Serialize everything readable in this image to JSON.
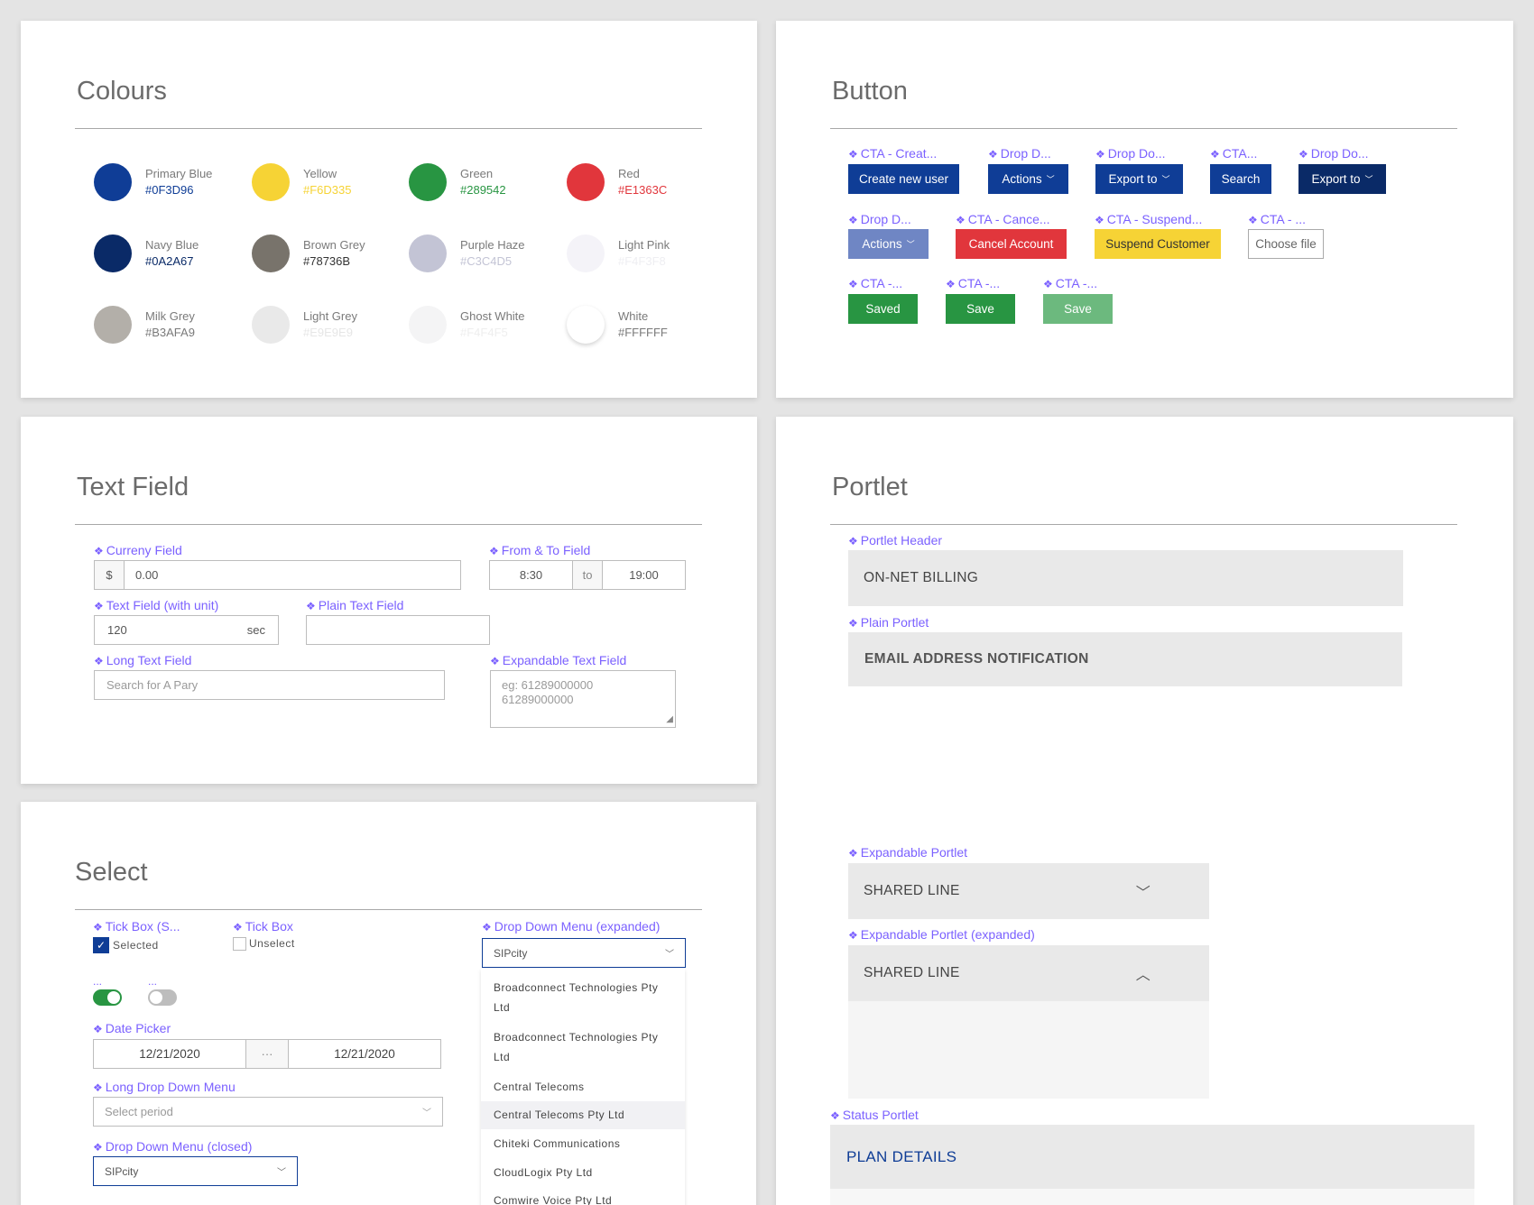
{
  "colours": {
    "title": "Colours",
    "items": [
      {
        "name": "Primary Blue",
        "hex": "#0F3D96",
        "color": "#0F3D96",
        "hex_color": "#0F3D96"
      },
      {
        "name": "Yellow",
        "hex": "#F6D335",
        "color": "#F6D335",
        "hex_color": "#F6D335"
      },
      {
        "name": "Green",
        "hex": "#289542",
        "color": "#289542",
        "hex_color": "#289542"
      },
      {
        "name": "Red",
        "hex": "#E1363C",
        "color": "#E1363C",
        "hex_color": "#E1363C"
      },
      {
        "name": "Navy Blue",
        "hex": "#0A2A67",
        "color": "#0A2A67",
        "hex_color": "#0A2A67"
      },
      {
        "name": "Brown Grey",
        "hex": "#78736B",
        "color": "#78736B",
        "hex_color": "#333333"
      },
      {
        "name": "Purple Haze",
        "hex": "#C3C4D5",
        "color": "#C3C4D5",
        "hex_color": "#C3C4D5"
      },
      {
        "name": "Light Pink",
        "hex": "#F4F3F8",
        "color": "#F4F3F8",
        "hex_color": "#EEEEF2"
      },
      {
        "name": "Milk Grey",
        "hex": "#B3AFA9",
        "color": "#B3AFA9",
        "hex_color": "#7A7A7A"
      },
      {
        "name": "Light Grey",
        "hex": "#E9E9E9",
        "color": "#E9E9E9",
        "hex_color": "#E6E6E6"
      },
      {
        "name": "Ghost White",
        "hex": "#F4F4F5",
        "color": "#F4F4F5",
        "hex_color": "#EEEEEE"
      },
      {
        "name": "White",
        "hex": "#FFFFFF",
        "color": "#FFFFFF",
        "hex_color": "#7A7A7A"
      }
    ]
  },
  "button": {
    "title": "Button",
    "labels": [
      "CTA - Creat...",
      "Drop D...",
      "Drop Do...",
      "CTA...",
      "Drop Do...",
      "Drop D...",
      "CTA - Cance...",
      "CTA - Suspend...",
      "CTA - ...",
      "CTA -...",
      "CTA -...",
      "CTA -..."
    ],
    "create_new_user": "Create new user",
    "actions": "Actions",
    "export_to": "Export to",
    "search": "Search",
    "cancel_account": "Cancel Account",
    "suspend_customer": "Suspend Customer",
    "choose_file": "Choose file",
    "saved": "Saved",
    "save": "Save",
    "colors": {
      "primary": "#0F3D96",
      "navy": "#0A2A67",
      "disabled_blue": "#6F86C4",
      "red": "#E1363C",
      "yellow": "#F6D335",
      "green": "#289542",
      "disabled_green": "#6CB97E"
    }
  },
  "text_field": {
    "title": "Text Field",
    "currency_label": "Curreny Field",
    "currency_symbol": "$",
    "currency_value": "0.00",
    "from_to_label": "From & To Field",
    "from_value": "8:30",
    "to_word": "to",
    "to_value": "19:00",
    "unit_label": "Text Field (with unit)",
    "unit_value": "120",
    "unit": "sec",
    "plain_label": "Plain Text Field",
    "long_label": "Long Text Field",
    "long_placeholder": "Search for A Pary",
    "expandable_label": "Expandable Text Field",
    "expandable_placeholder_1": "eg: 61289000000",
    "expandable_placeholder_2": "61289000000"
  },
  "select": {
    "title": "Select",
    "tick_selected_label": "Tick Box (S...",
    "tick_selected_text": "Selected",
    "tick_label": "Tick Box",
    "tick_text": "Unselect",
    "toggle_on_label": "...",
    "toggle_off_label": "...",
    "date_label": "Date Picker",
    "date_from": "12/21/2020",
    "date_sep": "···",
    "date_to": "12/21/2020",
    "long_dd_label": "Long Drop Down Menu",
    "long_dd_placeholder": "Select period",
    "dd_closed_label": "Drop Down Menu (closed)",
    "dd_closed_value": "SIPcity",
    "dd_expanded_label": "Drop Down Menu (expanded)",
    "dd_expanded_value": "SIPcity",
    "dd_options": [
      "Broadconnect Technologies Pty",
      "Ltd",
      "Broadconnect Technologies Pty",
      "Ltd",
      "Central Telecoms",
      "Central Telecoms Pty Ltd",
      "Chiteki Communications",
      "CloudLogix Pty Ltd",
      "Comwire Voice Pty Ltd"
    ]
  },
  "portlet": {
    "title": "Portlet",
    "header_label": "Portlet Header",
    "header_text": "ON-NET BILLING",
    "plain_label": "Plain Portlet",
    "plain_text": "EMAIL ADDRESS NOTIFICATION",
    "expandable_label": "Expandable Portlet",
    "expandable_text": "SHARED LINE",
    "expanded_label": "Expandable Portlet (expanded)",
    "expanded_text": "SHARED LINE",
    "status_label": "Status Portlet",
    "status_text": "PLAN DETAILS"
  }
}
